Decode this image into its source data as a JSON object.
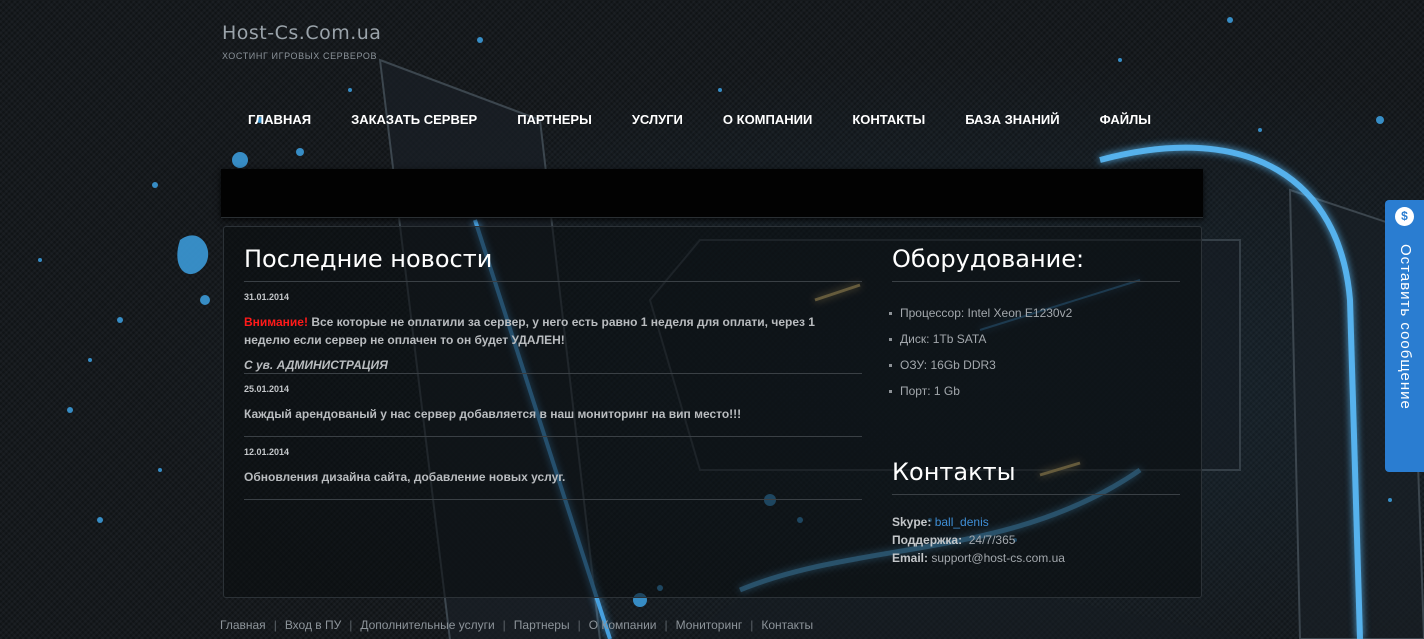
{
  "logo": {
    "title": "Host-Cs.Com.ua",
    "subtitle": "ХОСТИНГ ИГРОВЫХ СЕРВЕРОВ"
  },
  "nav": [
    "ГЛАВНАЯ",
    "ЗАКАЗАТЬ СЕРВЕР",
    "ПАРТНЕРЫ",
    "УСЛУГИ",
    "О КОМПАНИИ",
    "КОНТАКТЫ",
    "БАЗА ЗНАНИЙ",
    "ФАЙЛЫ"
  ],
  "news": {
    "title": "Последние новости",
    "items": [
      {
        "date": "31.01.2014",
        "warning": "Внимание!",
        "text": "Все которые не оплатили за сервер, у него есть равно 1 неделя для оплати, через 1 неделю если сервер не оплачен то он будет УДАЛЕН!",
        "signature": "С ув. АДМИНИСТРАЦИЯ"
      },
      {
        "date": "25.01.2014",
        "text": "Каждый арендованый у нас сервер добавляется в наш мониторинг на вип место!!!"
      },
      {
        "date": "12.01.2014",
        "text": "Обновления дизайна сайта, добавление новых услуг."
      }
    ]
  },
  "equipment": {
    "title": "Оборудование:",
    "items": [
      "Процессор: Intel Xeon E1230v2",
      "Диск: 1Tb SATA",
      "ОЗУ: 16Gb DDR3",
      "Порт: 1 Gb"
    ]
  },
  "contacts": {
    "title": "Контакты",
    "skype_label": "Skype:",
    "skype_value": "ball_denis",
    "support_label": "Поддержка:",
    "support_value": "24/7/365",
    "email_label": "Email:",
    "email_value": "support@host-cs.com.ua"
  },
  "footer": [
    "Главная",
    "Вход в ПУ",
    "Дополнительные услуги",
    "Партнеры",
    "О Компании",
    "Мониторинг",
    "Контакты"
  ],
  "feedback": {
    "label": "Оставить сообщение",
    "icon": "speech-bubble-dollar-icon"
  },
  "colors": {
    "accent": "#2a7dd1",
    "warning": "#ff1a1a",
    "link": "#3f8fd6",
    "glow": "#4fb6ff"
  }
}
